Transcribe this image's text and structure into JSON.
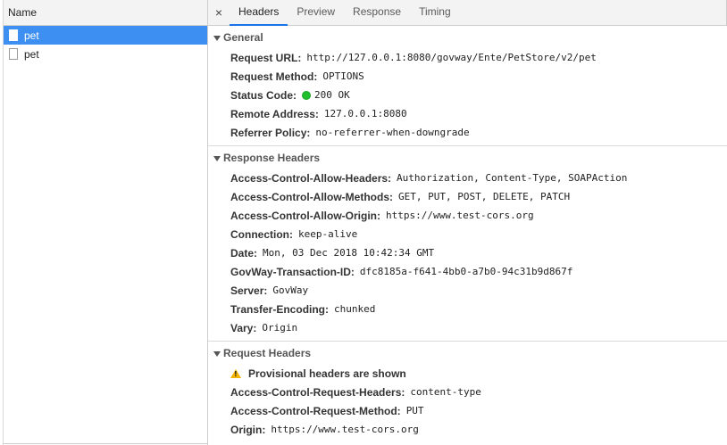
{
  "requests_panel": {
    "header": "Name",
    "items": [
      {
        "name": "pet",
        "selected": true
      },
      {
        "name": "pet",
        "selected": false
      }
    ]
  },
  "tabs": {
    "close": "×",
    "items": [
      {
        "label": "Headers",
        "active": true
      },
      {
        "label": "Preview",
        "active": false
      },
      {
        "label": "Response",
        "active": false
      },
      {
        "label": "Timing",
        "active": false
      }
    ]
  },
  "general": {
    "title": "General",
    "rows": [
      {
        "key": "Request URL:",
        "value": "http://127.0.0.1:8080/govway/Ente/PetStore/v2/pet"
      },
      {
        "key": "Request Method:",
        "value": "OPTIONS"
      },
      {
        "key": "Status Code:",
        "value": "200 OK"
      },
      {
        "key": "Remote Address:",
        "value": "127.0.0.1:8080"
      },
      {
        "key": "Referrer Policy:",
        "value": "no-referrer-when-downgrade"
      }
    ],
    "status_color": "#1fbf2c"
  },
  "response_headers": {
    "title": "Response Headers",
    "rows": [
      {
        "key": "Access-Control-Allow-Headers:",
        "value": "Authorization, Content-Type, SOAPAction"
      },
      {
        "key": "Access-Control-Allow-Methods:",
        "value": "GET, PUT, POST, DELETE, PATCH"
      },
      {
        "key": "Access-Control-Allow-Origin:",
        "value": "https://www.test-cors.org"
      },
      {
        "key": "Connection:",
        "value": "keep-alive"
      },
      {
        "key": "Date:",
        "value": "Mon, 03 Dec 2018 10:42:34 GMT"
      },
      {
        "key": "GovWay-Transaction-ID:",
        "value": "dfc8185a-f641-4bb0-a7b0-94c31b9d867f"
      },
      {
        "key": "Server:",
        "value": "GovWay"
      },
      {
        "key": "Transfer-Encoding:",
        "value": "chunked"
      },
      {
        "key": "Vary:",
        "value": "Origin"
      }
    ]
  },
  "request_headers": {
    "title": "Request Headers",
    "warning": "Provisional headers are shown",
    "rows": [
      {
        "key": "Access-Control-Request-Headers:",
        "value": "content-type"
      },
      {
        "key": "Access-Control-Request-Method:",
        "value": "PUT"
      },
      {
        "key": "Origin:",
        "value": "https://www.test-cors.org"
      }
    ]
  },
  "colors": {
    "selection": "#3d8ff1",
    "active_tab_underline": "#1a73e8",
    "warning": "#f4b400"
  }
}
